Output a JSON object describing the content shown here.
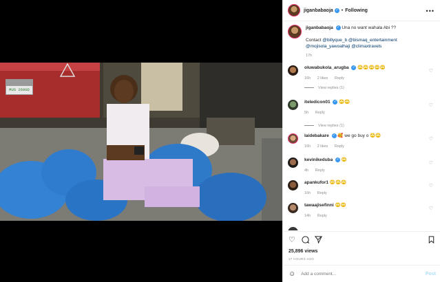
{
  "header": {
    "username": "jiganbabaoja",
    "verified": "✓",
    "separator": "•",
    "follow_label": "Following",
    "more": "•••"
  },
  "video": {
    "plate": "MUS 260GD"
  },
  "caption": {
    "username": "jiganbabaoja",
    "text": "Una no want wahala Abi ??",
    "contact_prefix": "Contact",
    "mentions": "@billyque_b @bismaq_entertainment @mojisola_yawoalhaji @climaxtravels",
    "time": "17h"
  },
  "comments": [
    {
      "username": "oluwabukola_arugba",
      "verified": true,
      "text": "🙄🙄🙄🙄🙄",
      "time": "16h",
      "likes": "2 likes",
      "reply": "Reply",
      "view_replies": "View replies (1)"
    },
    {
      "username": "iteledicon01",
      "verified": true,
      "text": "🙄🙄",
      "time": "5h",
      "likes": "",
      "reply": "Reply",
      "view_replies": "View replies (1)"
    },
    {
      "username": "laidebakare",
      "verified": true,
      "text": "🥰 we go buy o 🙄🙄",
      "time": "16h",
      "likes": "2 likes",
      "reply": "Reply",
      "view_replies": ""
    },
    {
      "username": "kevinikeduba",
      "verified": true,
      "text": "🙄",
      "time": "4h",
      "likes": "",
      "reply": "Reply",
      "view_replies": ""
    },
    {
      "username": "apankufor1",
      "verified": false,
      "text": "🙄🙄🙄",
      "time": "16h",
      "likes": "",
      "reply": "Reply",
      "view_replies": ""
    },
    {
      "username": "tawaajisefinni",
      "verified": false,
      "text": "🙄🙄",
      "time": "14h",
      "likes": "",
      "reply": "Reply",
      "view_replies": ""
    }
  ],
  "stats": {
    "likes": "25,896 views",
    "ago": "17 HOURS AGO"
  },
  "add_comment": {
    "placeholder": "Add a comment...",
    "post_label": "Post"
  },
  "colors": {
    "accent": "#3897f0",
    "link": "#00376b",
    "muted": "#8e8e8e"
  }
}
